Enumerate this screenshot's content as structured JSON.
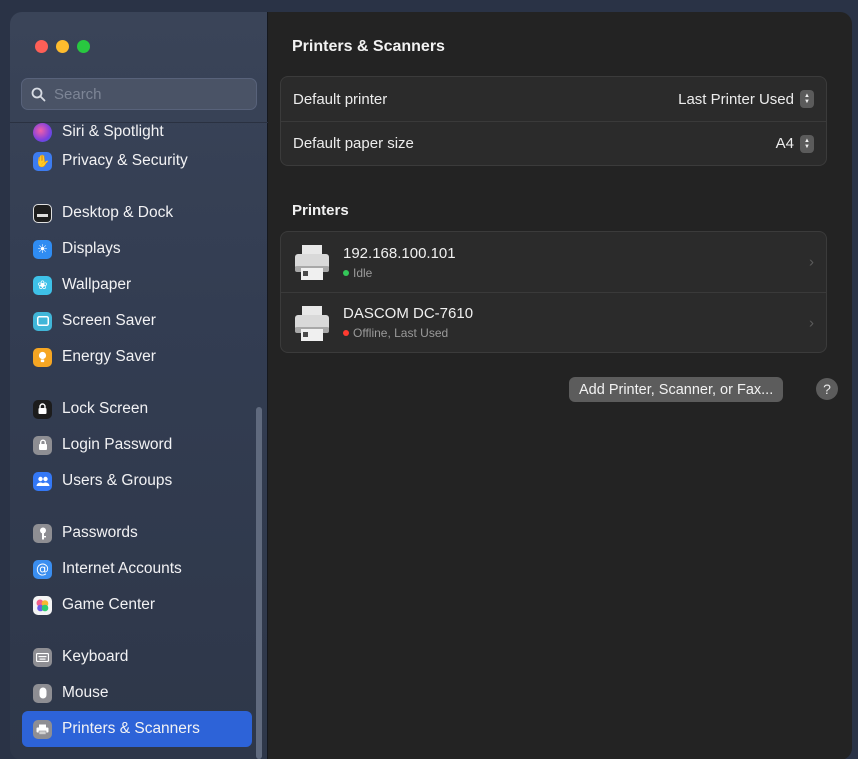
{
  "search": {
    "placeholder": "Search"
  },
  "sidebar": {
    "items": [
      {
        "label": "Siri & Spotlight",
        "icon": "siri-icon",
        "color": "#a24dd4"
      },
      {
        "label": "Privacy & Security",
        "icon": "hand-icon",
        "color": "#3d7cf0"
      },
      {
        "label": "Desktop & Dock",
        "icon": "dock-icon",
        "color": "#2a2a2a"
      },
      {
        "label": "Displays",
        "icon": "sun-icon",
        "color": "#2f8cf2"
      },
      {
        "label": "Wallpaper",
        "icon": "flower-icon",
        "color": "#3ec1e8"
      },
      {
        "label": "Screen Saver",
        "icon": "screen-saver-icon",
        "color": "#41b6d8"
      },
      {
        "label": "Energy Saver",
        "icon": "bulb-icon",
        "color": "#f6a623"
      },
      {
        "label": "Lock Screen",
        "icon": "lock-icon",
        "color": "#1f1f1f"
      },
      {
        "label": "Login Password",
        "icon": "padlock-icon",
        "color": "#8e8e93"
      },
      {
        "label": "Users & Groups",
        "icon": "users-icon",
        "color": "#3478f6"
      },
      {
        "label": "Passwords",
        "icon": "key-icon",
        "color": "#8e8e93"
      },
      {
        "label": "Internet Accounts",
        "icon": "at-icon",
        "color": "#3a8ef0"
      },
      {
        "label": "Game Center",
        "icon": "game-center-icon",
        "color": "#f0f0f0"
      },
      {
        "label": "Keyboard",
        "icon": "keyboard-icon",
        "color": "#8e8e93"
      },
      {
        "label": "Mouse",
        "icon": "mouse-icon",
        "color": "#8e8e93"
      },
      {
        "label": "Printers & Scanners",
        "icon": "printer-icon",
        "color": "#8e8e93",
        "selected": true
      }
    ]
  },
  "main": {
    "title": "Printers & Scanners",
    "defaults": {
      "printer_label": "Default printer",
      "printer_value": "Last Printer Used",
      "paper_label": "Default paper size",
      "paper_value": "A4"
    },
    "printers_heading": "Printers",
    "printers": [
      {
        "name": "192.168.100.101",
        "status": "Idle",
        "status_color": "#34c759"
      },
      {
        "name": "DASCOM DC-7610",
        "status": "Offline, Last Used",
        "status_color": "#ff3b30"
      }
    ],
    "add_button": "Add Printer, Scanner, or Fax...",
    "help_label": "?"
  }
}
